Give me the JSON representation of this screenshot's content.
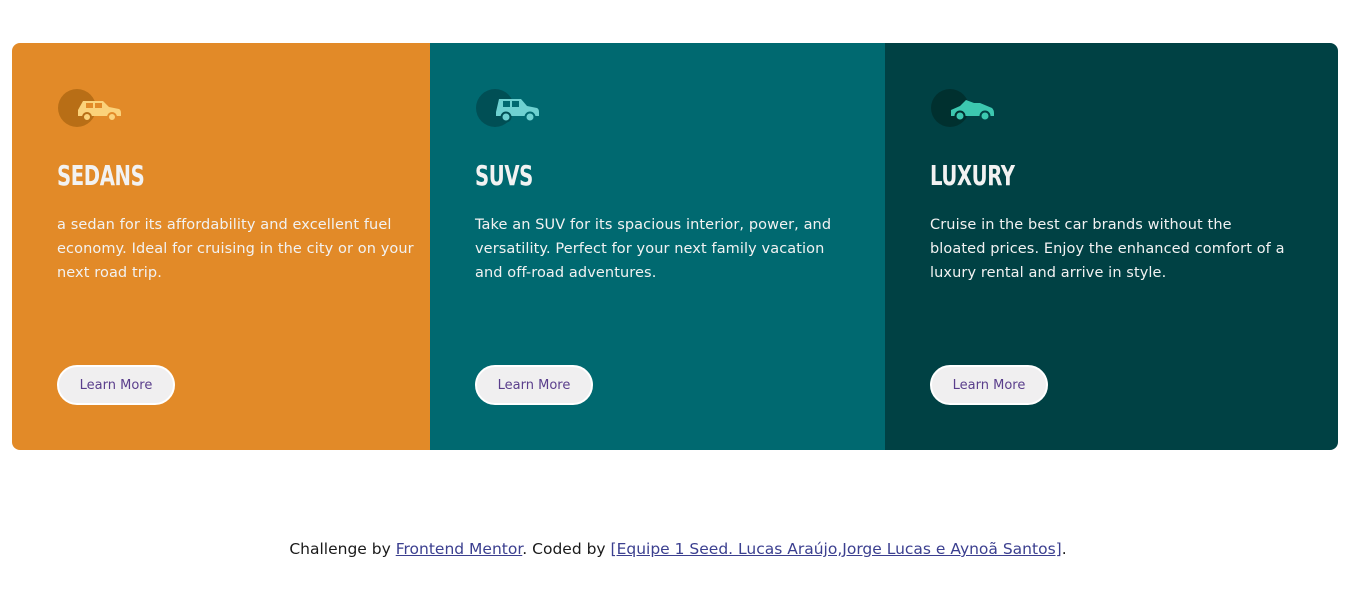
{
  "cards": [
    {
      "icon": "sedan-car-icon",
      "title": "Sedans",
      "text": "a sedan for its affordability and excellent fuel economy. Ideal for cruising in the city or on your next road trip.",
      "button_label": "Learn More",
      "bg_color": "#e28a28"
    },
    {
      "icon": "suv-car-icon",
      "title": "SUVs",
      "text": "Take an SUV for its spacious interior, power, and versatility. Perfect for your next family vacation and off-road adventures.",
      "button_label": "Learn More",
      "bg_color": "#006970"
    },
    {
      "icon": "luxury-car-icon",
      "title": "Luxury",
      "text": "Cruise in the best car brands without the bloated prices. Enjoy the enhanced comfort of a luxury rental and arrive in style.",
      "button_label": "Learn More",
      "bg_color": "#004144"
    }
  ],
  "footer": {
    "prefix": "Challenge by ",
    "link1": "Frontend Mentor",
    "middle": ". Coded by ",
    "link2": "[Equipe 1 Seed. Lucas Araújo,Jorge Lucas e Aynoã Santos]",
    "suffix": "."
  },
  "colors": {
    "button_text": "#5a3e8c",
    "link": "#3b3f8f"
  }
}
